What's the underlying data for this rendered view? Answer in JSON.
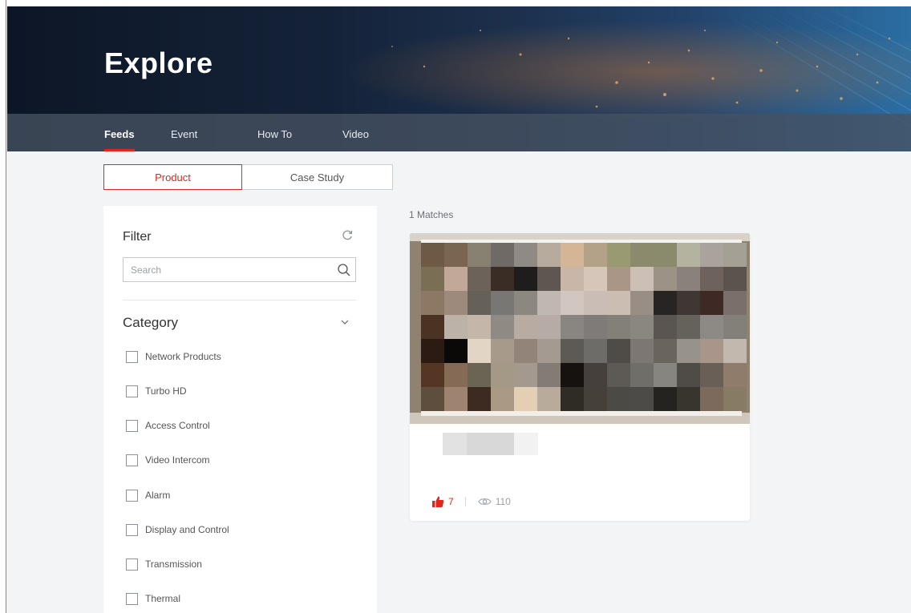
{
  "hero": {
    "title": "Explore"
  },
  "nav": {
    "tabs": [
      {
        "label": "Feeds",
        "active": true
      },
      {
        "label": "Event",
        "active": false
      },
      {
        "label": "How To",
        "active": false
      },
      {
        "label": "Video",
        "active": false
      }
    ]
  },
  "segments": {
    "product": "Product",
    "case_study": "Case Study",
    "selected": "Product"
  },
  "filter": {
    "title": "Filter",
    "search_placeholder": "Search",
    "category_title": "Category",
    "categories": [
      "Network Products",
      "Turbo HD",
      "Access Control",
      "Video Intercom",
      "Alarm",
      "Display and Control",
      "Transmission",
      "Thermal"
    ]
  },
  "results": {
    "matches_text": "1 Matches"
  },
  "card": {
    "likes": "7",
    "views": "110"
  },
  "colors": {
    "accent": "#e1261c",
    "hero_dark": "#0d1626",
    "hero_light": "#2b6ea3",
    "page_bg": "#f3f4f6"
  },
  "icons": [
    "refresh-icon",
    "search-icon",
    "chevron-down-icon",
    "thumbs-up-icon",
    "eye-icon"
  ]
}
